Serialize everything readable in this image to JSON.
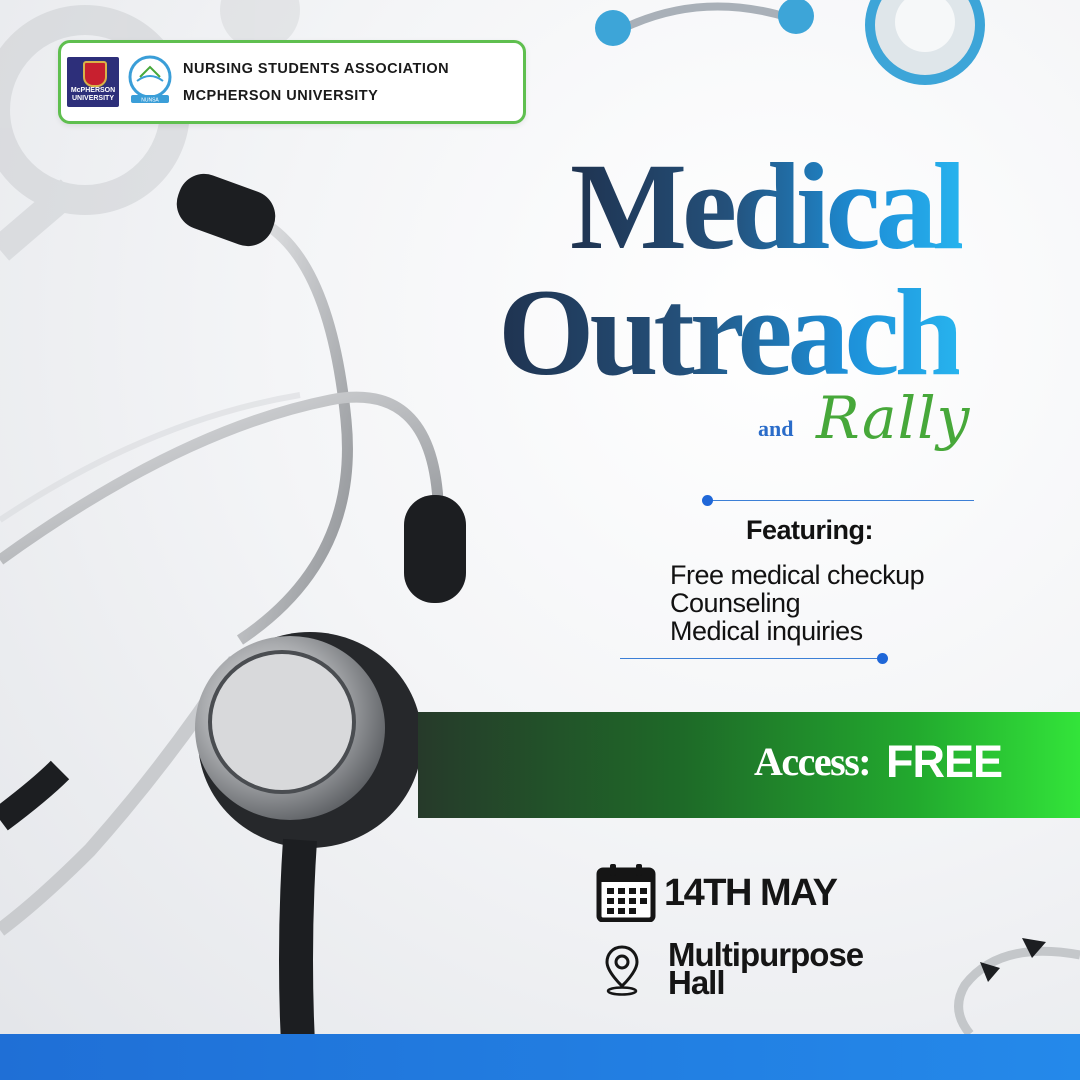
{
  "organization": {
    "university_logo_text": "McPHERSON UNIVERSITY",
    "association_logo_text": "NUNSA",
    "name_line1": "NURSING STUDENTS ASSOCIATION",
    "name_line2": "MCPHERSON UNIVERSITY",
    "border_color": "#5fbf4f"
  },
  "title": {
    "line1": "Medical",
    "line2": "Outreach",
    "connector": "and",
    "line3": "Rally"
  },
  "featuring": {
    "heading": "Featuring:",
    "items": [
      "Free medical checkup",
      "Counseling",
      "Medical inquiries"
    ]
  },
  "access": {
    "label": "Access:",
    "value": "FREE",
    "band_colors": [
      "#263a2a",
      "#33e43a"
    ]
  },
  "event": {
    "date": "14TH MAY",
    "venue_line1": "Multipurpose",
    "venue_line2": "Hall",
    "date_icon": "calendar-icon",
    "venue_icon": "location-pin-icon"
  },
  "colors": {
    "title_gradient": [
      "#1f3350",
      "#27b3ee"
    ],
    "rally": "#47a83a",
    "accent_blue": "#1f6fd6"
  }
}
